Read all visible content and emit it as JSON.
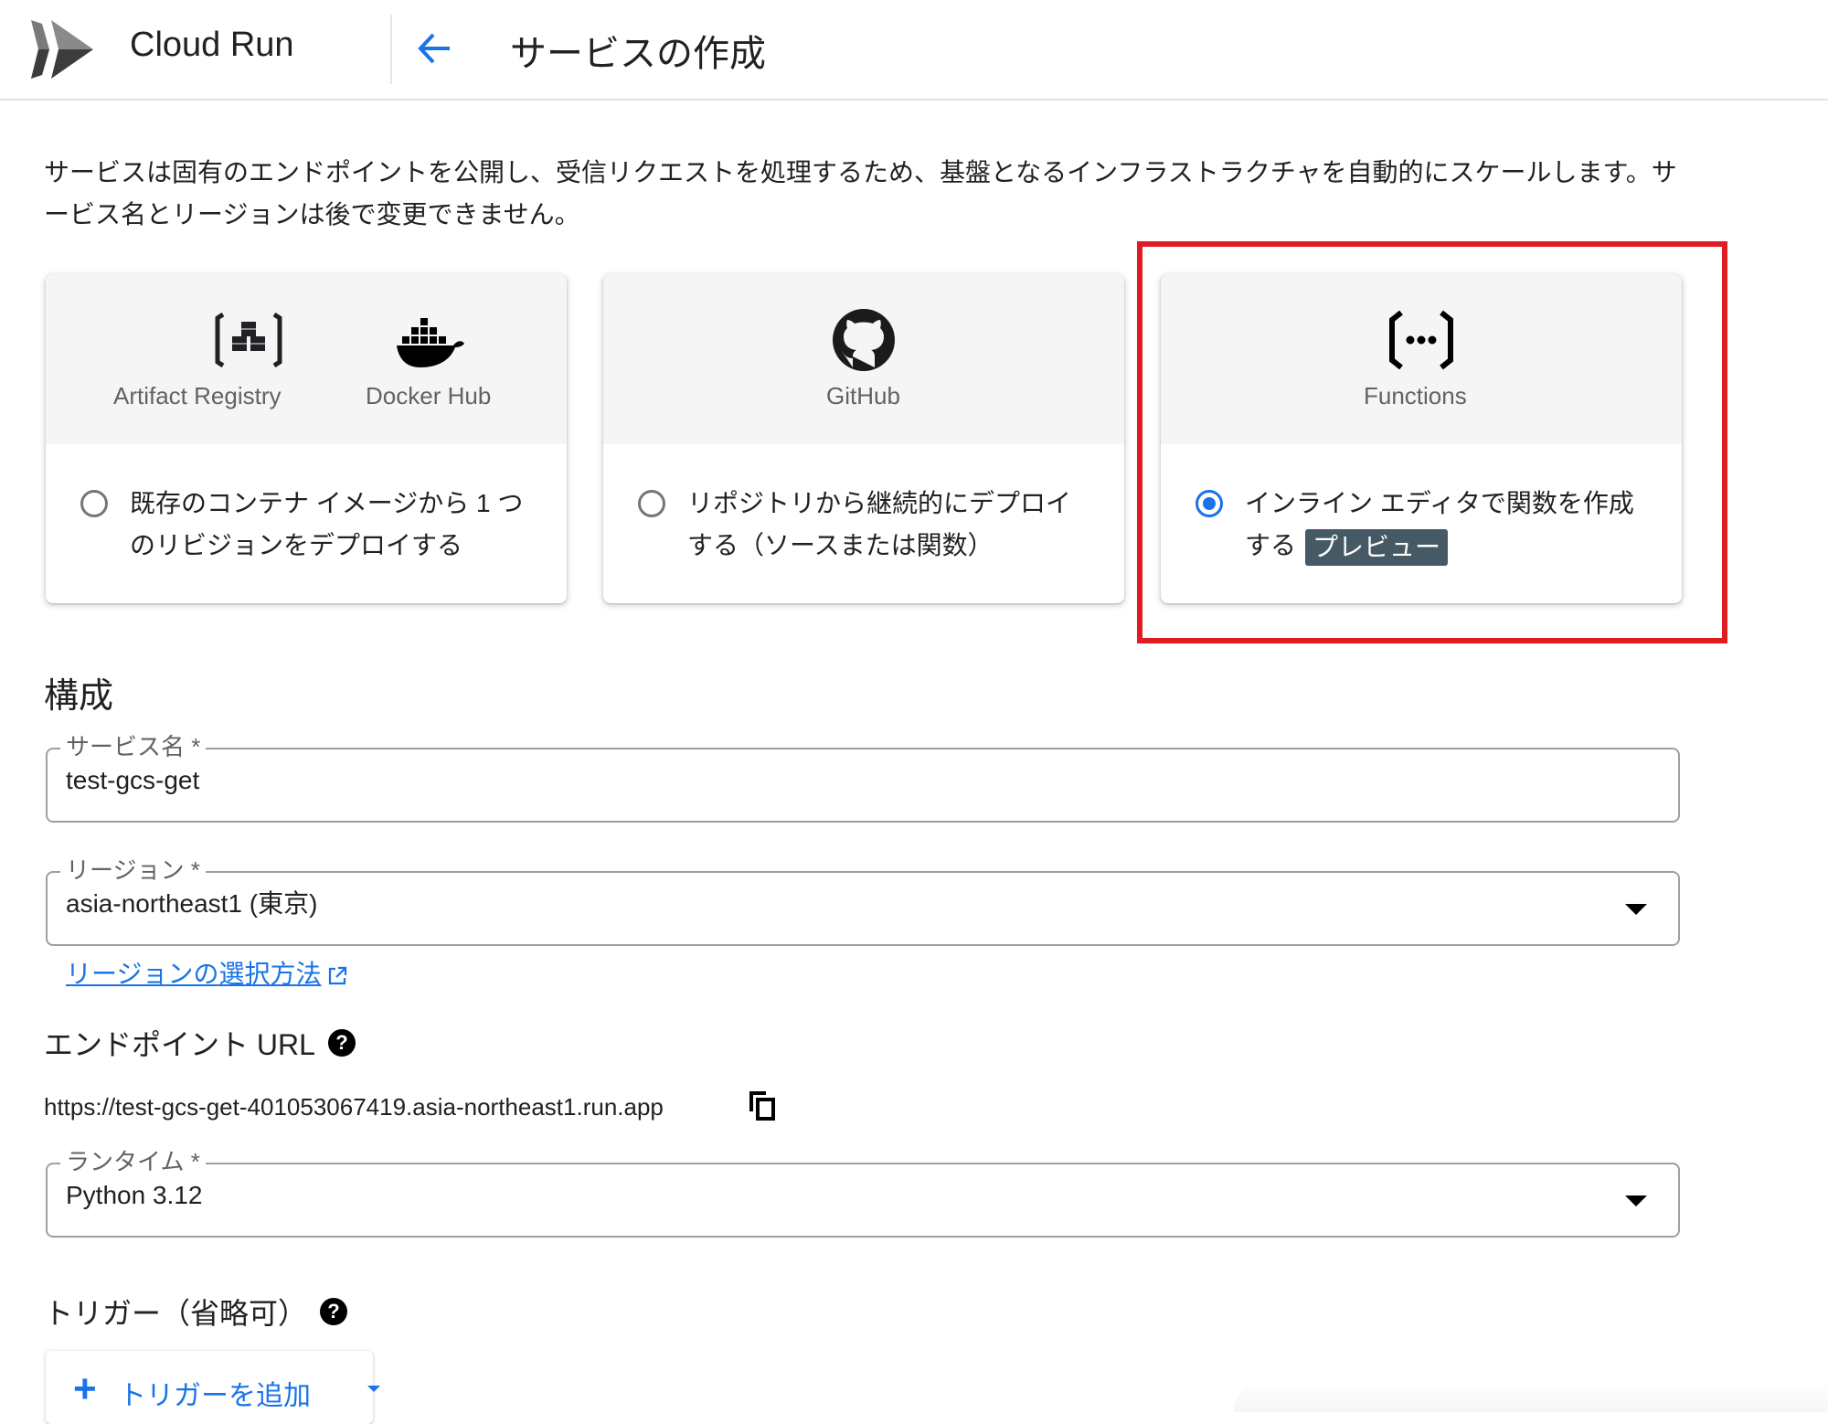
{
  "header": {
    "app_title": "Cloud Run",
    "page_title": "サービスの作成",
    "back_icon": "arrow-left-icon",
    "logo_icon": "cloud-run-logo-icon"
  },
  "description": "サービスは固有のエンドポイントを公開し、受信リクエストを処理するため、基盤となるインフラストラクチャを自動的にスケールします。サービス名とリージョンは後で変更できません。",
  "deploy_options": [
    {
      "sources": [
        {
          "label": "Artifact Registry",
          "icon": "artifact-registry-icon"
        },
        {
          "label": "Docker Hub",
          "icon": "docker-icon"
        }
      ],
      "text": "既存のコンテナ イメージから 1 つのリビジョンをデプロイする",
      "selected": false
    },
    {
      "sources": [
        {
          "label": "GitHub",
          "icon": "github-icon"
        }
      ],
      "text": "リポジトリから継続的にデプロイする（ソースまたは関数）",
      "selected": false
    },
    {
      "sources": [
        {
          "label": "Functions",
          "icon": "functions-icon"
        }
      ],
      "text": "インライン エディタで関数を作成する",
      "badge": "プレビュー",
      "selected": true
    }
  ],
  "highlight_color": "#e11b22",
  "accent_color": "#1a73e8",
  "config": {
    "section_title": "構成",
    "service_name": {
      "label": "サービス名 *",
      "value": "test-gcs-get"
    },
    "region": {
      "label": "リージョン *",
      "value": "asia-northeast1 (東京)"
    },
    "region_help_link": "リージョンの選択方法",
    "endpoint": {
      "heading": "エンドポイント URL",
      "url": "https://test-gcs-get-401053067419.asia-northeast1.run.app"
    },
    "runtime": {
      "label": "ランタイム *",
      "value": "Python 3.12"
    },
    "trigger": {
      "heading": "トリガー（省略可）",
      "add_button": "トリガーを追加"
    },
    "help_glyph": "?"
  }
}
